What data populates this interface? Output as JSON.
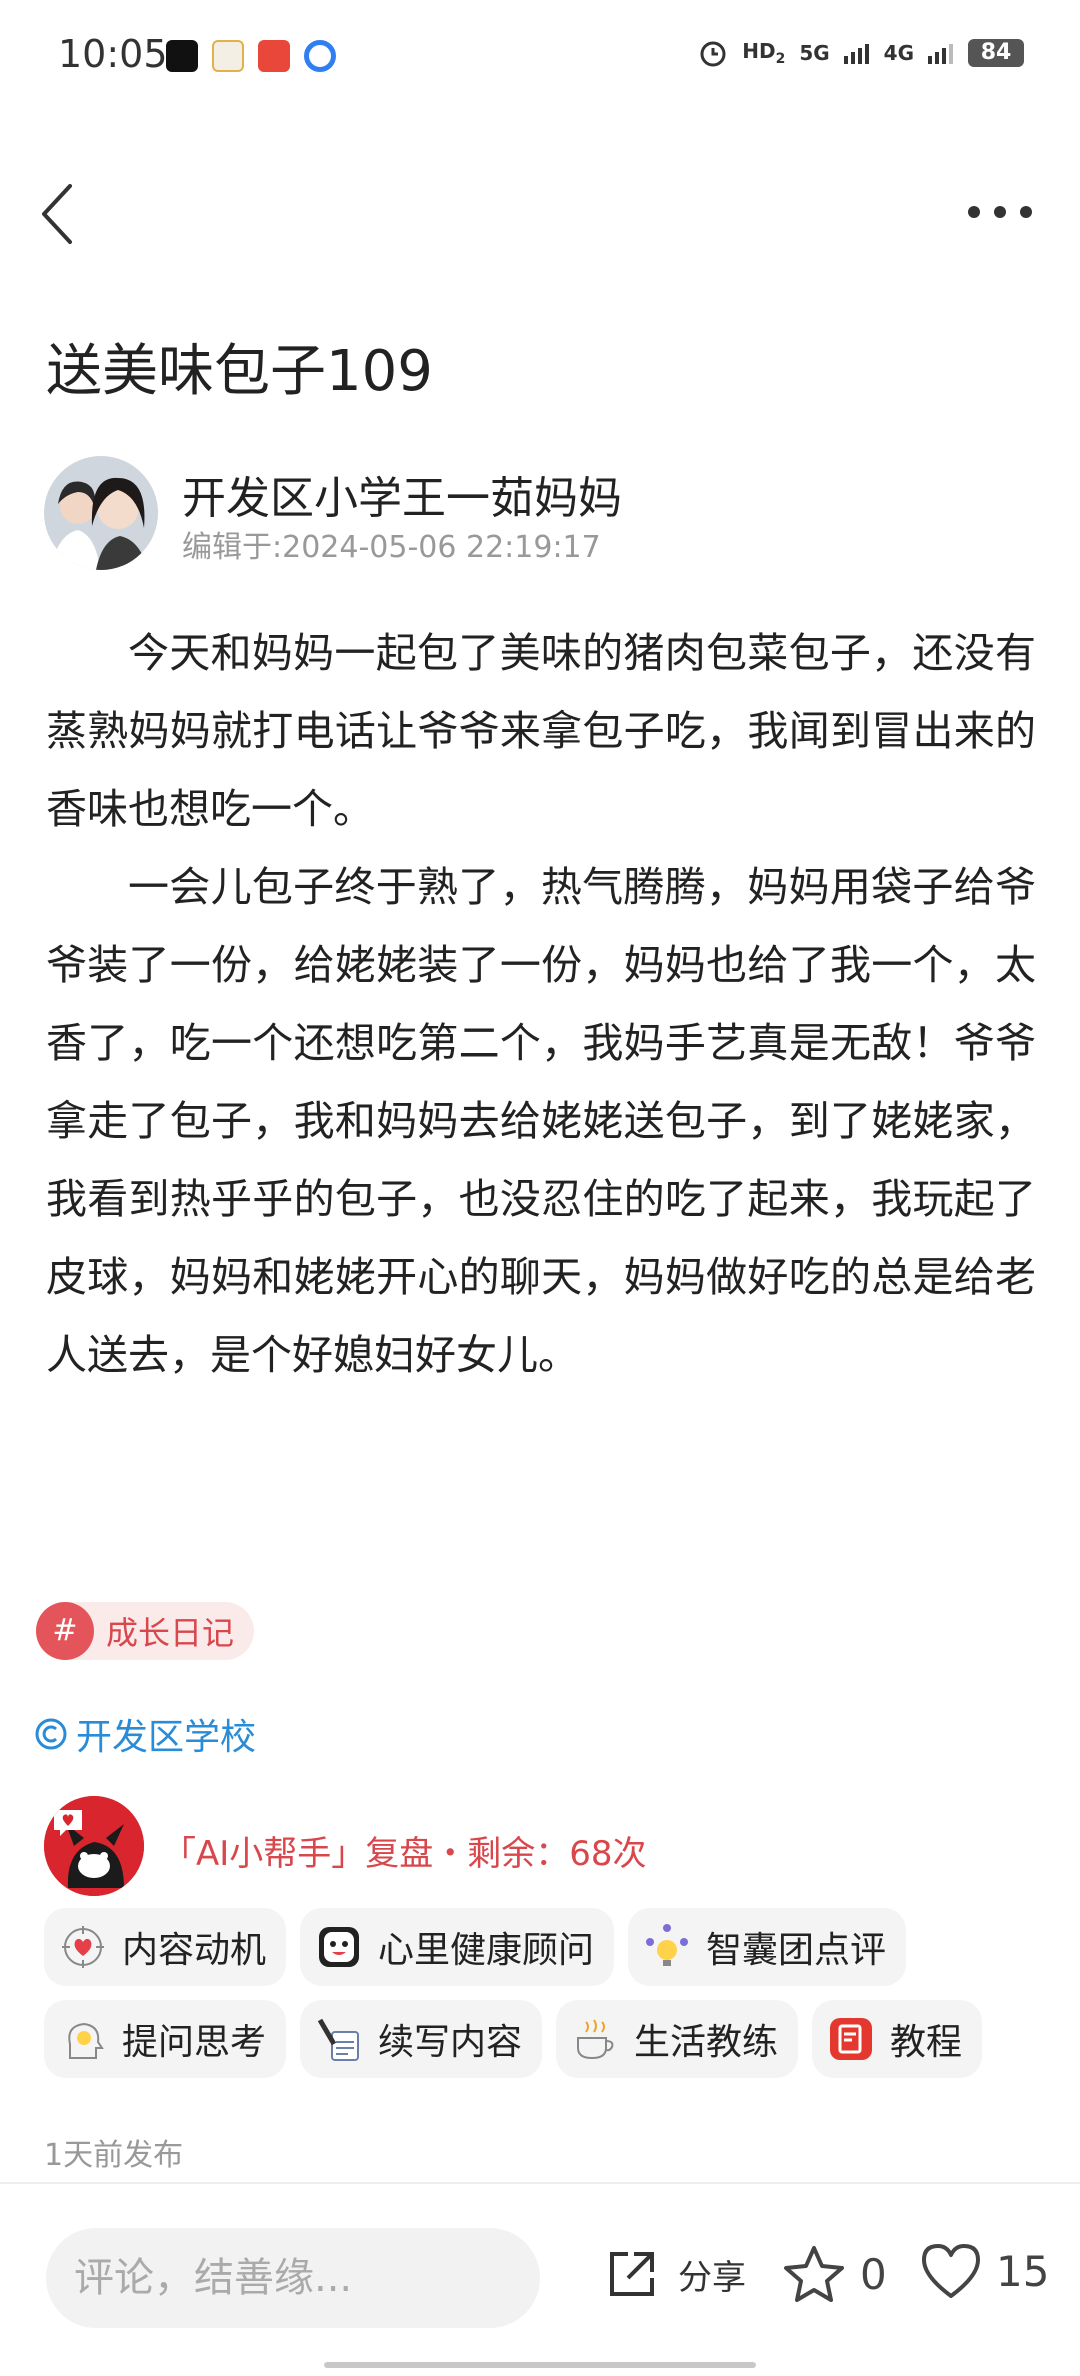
{
  "status_bar": {
    "time": "10:05",
    "battery": "84",
    "network_1": "5G",
    "network_2": "4G",
    "hd_label": "HD",
    "hd_sub": "2"
  },
  "post": {
    "title": "送美味包子109",
    "author_name": "开发区小学王一茹妈妈",
    "edit_time": "编辑于:2024-05-06 22:19:17",
    "paragraphs": [
      "今天和妈妈一起包了美味的猪肉包菜包子，还没有蒸熟妈妈就打电话让爷爷来拿包子吃，我闻到冒出来的香味也想吃一个。",
      "一会儿包子终于熟了，热气腾腾，妈妈用袋子给爷爷装了一份，给姥姥装了一份，妈妈也给了我一个，太香了，吃一个还想吃第二个，我妈手艺真是无敌！爷爷拿走了包子，我和妈妈去给姥姥送包子，到了姥姥家，我看到热乎乎的包子，也没忍住的吃了起来，我玩起了皮球，妈妈和姥姥开心的聊天，妈妈做好吃的总是给老人送去，是个好媳妇好女儿。"
    ],
    "tag_hash": "#",
    "tag_label": "成长日记",
    "location": "开发区学校",
    "ai_text": "「AI小帮手」复盘・剩余：68次",
    "publish_time": "1天前发布"
  },
  "chips": {
    "row1": [
      "内容动机",
      "心里健康顾问",
      "智囊团点评"
    ],
    "row2": [
      "提问思考",
      "续写内容",
      "生活教练",
      "教程"
    ]
  },
  "bottom_bar": {
    "comment_placeholder": "评论，结善缘...",
    "share_label": "分享",
    "star_count": "0",
    "like_count": "15"
  },
  "colors": {
    "accent_red": "#d8474c",
    "link_blue": "#2a8bd6"
  }
}
